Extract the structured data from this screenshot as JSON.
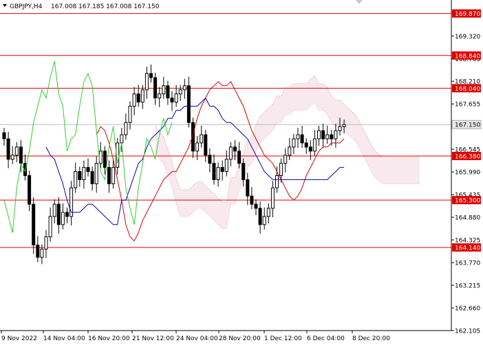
{
  "header": {
    "symbol": "GBPJPY,H4",
    "ohlc": "167.008 167.185 167.008 167.150"
  },
  "colors": {
    "up_candle": "#000000",
    "down_candle": "#000000",
    "tenkan": "#cc0000",
    "kijun": "#0000aa",
    "chikou": "#33cc33",
    "cloud_a": "#cc9966",
    "cloud_b": "#e2a8c0",
    "level_line": "#dd0000",
    "level_box": "#dd0000",
    "current_box": "#e8e8e8"
  },
  "chart_data": {
    "type": "candlestick",
    "ylim": [
      162.105,
      170.2
    ],
    "y_ticks": [
      "169.320",
      "168.765",
      "168.210",
      "167.655",
      "166.545",
      "165.990",
      "165.435",
      "164.880",
      "164.325",
      "163.770",
      "163.215",
      "162.660",
      "162.105"
    ],
    "x_ticks": [
      "9 Nov 2022",
      "14 Nov 04:00",
      "16 Nov 20:00",
      "21 Nov 12:00",
      "24 Nov 04:00",
      "28 Nov 20:00",
      "1 Dec 12:00",
      "6 Dec 04:00",
      "8 Dec 20:00"
    ],
    "levels": [
      {
        "value": 169.87,
        "label": "169.870"
      },
      {
        "value": 168.84,
        "label": "168.840"
      },
      {
        "value": 168.04,
        "label": "168.040"
      },
      {
        "value": 166.38,
        "label": "166.380"
      },
      {
        "value": 165.3,
        "label": "165.300"
      },
      {
        "value": 164.14,
        "label": "164.140"
      }
    ],
    "current_price": {
      "value": 167.15,
      "label": "167.150"
    },
    "close": [
      166.8,
      166.3,
      166.4,
      166.6,
      166.2,
      165.9,
      165.2,
      164.2,
      163.9,
      164.1,
      164.4,
      164.9,
      165.2,
      164.7,
      165.0,
      164.9,
      165.6,
      166.0,
      165.8,
      166.1,
      166.0,
      165.7,
      166.2,
      166.5,
      166.1,
      165.7,
      166.1,
      166.7,
      166.9,
      167.2,
      167.6,
      167.9,
      167.7,
      168.0,
      168.4,
      168.3,
      167.8,
      167.9,
      168.1,
      167.8,
      167.7,
      167.9,
      168.0,
      168.1,
      167.2,
      166.5,
      166.7,
      166.9,
      166.4,
      166.2,
      165.8,
      166.1,
      166.0,
      166.3,
      166.6,
      166.5,
      166.2,
      165.8,
      165.4,
      165.2,
      165.1,
      164.7,
      164.9,
      165.1,
      165.6,
      165.9,
      166.2,
      166.4,
      166.6,
      166.8,
      166.9,
      166.7,
      166.6,
      166.5,
      166.8,
      167.0,
      166.8,
      166.9,
      166.8,
      167.0,
      167.1,
      167.15
    ],
    "kijun": [
      166.6,
      166.4,
      166.3,
      166.0,
      165.7,
      165.3,
      165.0,
      165.0,
      165.0,
      165.1,
      165.2,
      165.2,
      165.1,
      165.0,
      164.9,
      164.8,
      164.7,
      164.7,
      165.3,
      165.3,
      165.6,
      165.9,
      166.2,
      166.3,
      166.6,
      166.8,
      166.9,
      167.0,
      167.1,
      167.3,
      167.3,
      167.5,
      167.5,
      167.6,
      167.6,
      167.6,
      167.6,
      167.7,
      167.8,
      167.6,
      167.6,
      167.5,
      167.3,
      167.2,
      167.2,
      167.1,
      167.0,
      166.9,
      166.8,
      166.6,
      166.4,
      166.2,
      166.0,
      165.9,
      165.8,
      165.8,
      165.8,
      165.8,
      165.8,
      165.8,
      165.8,
      165.8,
      165.8,
      165.8,
      165.8,
      165.8,
      165.8,
      165.8,
      165.9,
      166.0,
      166.1,
      166.1
    ],
    "tenkan": [
      166.9,
      167.1,
      167.0,
      166.7,
      166.3,
      165.8,
      165.3,
      164.7,
      164.4,
      164.3,
      164.5,
      164.8,
      165.0,
      165.2,
      165.4,
      165.6,
      165.8,
      165.9,
      166.0,
      166.0,
      166.2,
      166.4,
      166.6,
      166.9,
      167.3,
      167.6,
      167.8,
      168.0,
      168.1,
      168.2,
      168.1,
      168.1,
      168.2,
      168.0,
      167.8,
      167.6,
      167.3,
      167.0,
      166.8,
      166.6,
      166.4,
      166.3,
      166.2,
      166.0,
      165.8,
      165.6,
      165.4,
      165.3,
      165.4,
      165.6,
      165.9,
      166.1,
      166.3,
      166.5,
      166.6,
      166.6,
      166.7,
      166.7,
      166.7,
      166.8
    ],
    "chikou": [
      165.3,
      164.9,
      164.5,
      165.6,
      166.2,
      166.0,
      166.5,
      167.2,
      167.6,
      168.0,
      167.8,
      168.3,
      168.7,
      167.9,
      167.6,
      166.5,
      166.8,
      166.9,
      167.6,
      168.2,
      168.4,
      168.1,
      167.0,
      166.0,
      165.8,
      166.6,
      167.1,
      166.2,
      166.7,
      165.6,
      165.1,
      164.7,
      165.6,
      166.2,
      166.8,
      166.6,
      166.3,
      166.9,
      167.3,
      166.9,
      167.2
    ]
  }
}
